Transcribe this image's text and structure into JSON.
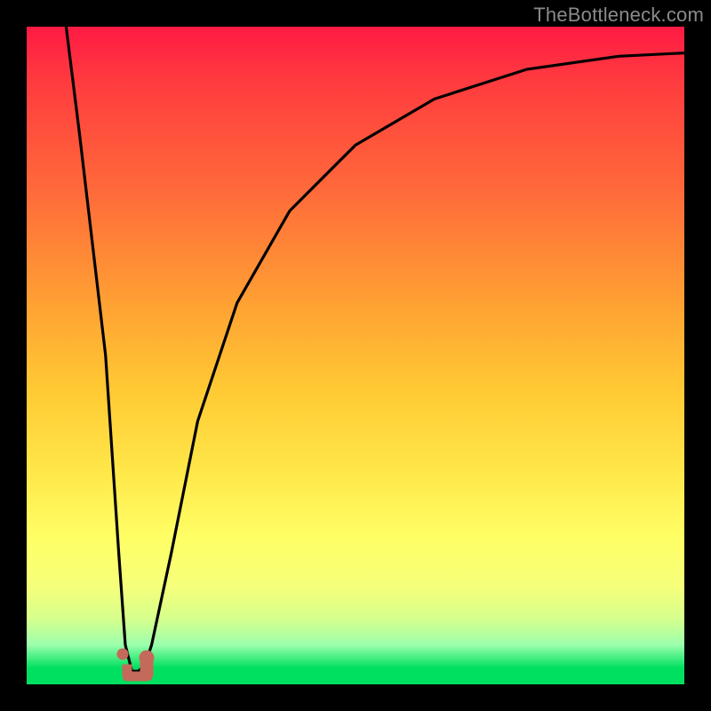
{
  "watermark": {
    "text": "TheBottleneck.com"
  },
  "chart_data": {
    "type": "line",
    "title": "",
    "xlabel": "",
    "ylabel": "",
    "xlim": [
      0,
      100
    ],
    "ylim": [
      0,
      100
    ],
    "grid": false,
    "legend": null,
    "background_gradient": {
      "top": "#ff1a44",
      "bottom": "#00e060",
      "meaning": "red = bad / bottleneck, green = good / no bottleneck"
    },
    "notch": {
      "x_range": [
        14,
        19
      ],
      "y": 2,
      "color": "#c96a5a",
      "meaning": "optimal region marker"
    },
    "series": [
      {
        "name": "curve",
        "x": [
          6,
          8,
          10,
          12,
          14,
          15,
          16,
          17,
          18,
          19,
          22,
          26,
          32,
          40,
          50,
          62,
          76,
          90,
          100
        ],
        "y": [
          100,
          84,
          67,
          50,
          20,
          6,
          2,
          2,
          3,
          6,
          20,
          40,
          58,
          72,
          82,
          89,
          93.5,
          95.5,
          96
        ]
      }
    ]
  }
}
